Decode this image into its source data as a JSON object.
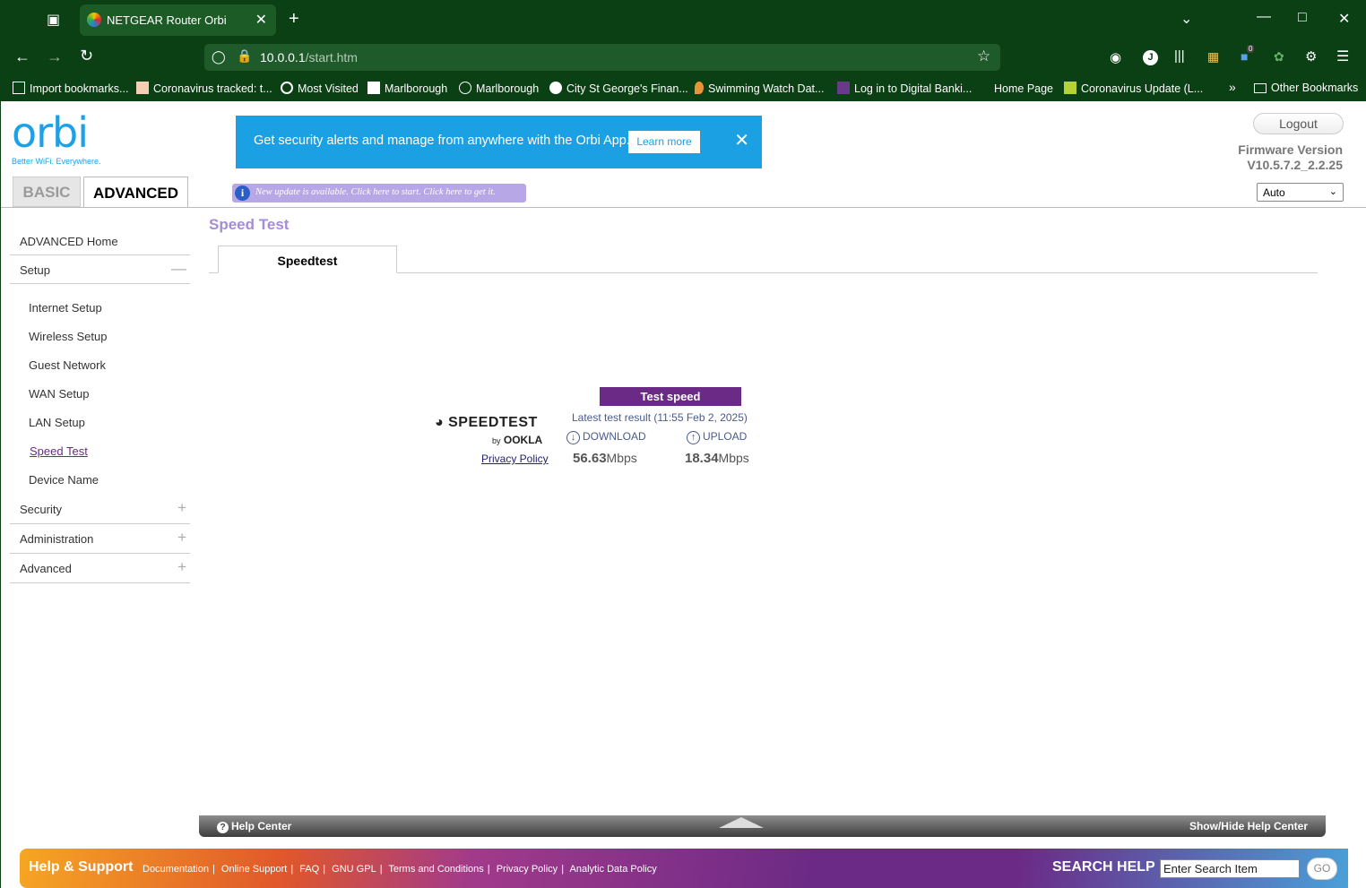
{
  "browser": {
    "tab_title": "NETGEAR Router Orbi",
    "url_host": "10.0.0.1",
    "url_path": "/start.htm",
    "bookmarks": [
      "Import bookmarks...",
      "Coronavirus tracked: t...",
      "Most Visited",
      "Marlborough",
      "Marlborough",
      "City St George's Finan...",
      "Swimming Watch Dat...",
      "Log in to Digital Banki...",
      "Home Page",
      "Coronavirus Update (L...",
      "Other Bookmarks"
    ],
    "account_initial": "J",
    "badge_count": "0"
  },
  "header": {
    "logo": "orbi",
    "tagline": "Better WiFi. Everywhere.",
    "tabs": {
      "basic": "BASIC",
      "advanced": "ADVANCED"
    },
    "banner_text": "Get security alerts and manage from anywhere with the Orbi App.",
    "banner_button": "Learn more",
    "update_notice": "New update is available. Click here to start. Click here to get it.",
    "logout": "Logout",
    "firmware_label": "Firmware Version",
    "firmware_version": "V10.5.7.2_2.2.25",
    "language": "Auto"
  },
  "sidebar": {
    "home": "ADVANCED Home",
    "setup": "Setup",
    "setup_items": [
      "Internet Setup",
      "Wireless Setup",
      "Guest Network",
      "WAN Setup",
      "LAN Setup",
      "Speed Test",
      "Device Name"
    ],
    "security": "Security",
    "administration": "Administration",
    "advanced": "Advanced"
  },
  "main": {
    "title": "Speed Test",
    "tab": "Speedtest",
    "speedtest_logo": "SPEEDTEST",
    "by": "by",
    "ookla": "OOKLA",
    "privacy_policy": "Privacy Policy",
    "test_button": "Test speed",
    "latest": "Latest test result (11:55 Feb 2, 2025)",
    "download_label": "DOWNLOAD",
    "upload_label": "UPLOAD",
    "download_value": "56.63",
    "upload_value": "18.34",
    "unit": "Mbps"
  },
  "help": {
    "help_center": "Help Center",
    "show_hide": "Show/Hide Help Center",
    "help_support": "Help & Support",
    "links": [
      "Documentation",
      "Online Support",
      "FAQ",
      "GNU GPL",
      "Terms and Conditions",
      "Privacy Policy",
      "Analytic Data Policy"
    ],
    "search_help": "SEARCH HELP",
    "search_value": "Enter Search Item",
    "go": "GO"
  }
}
